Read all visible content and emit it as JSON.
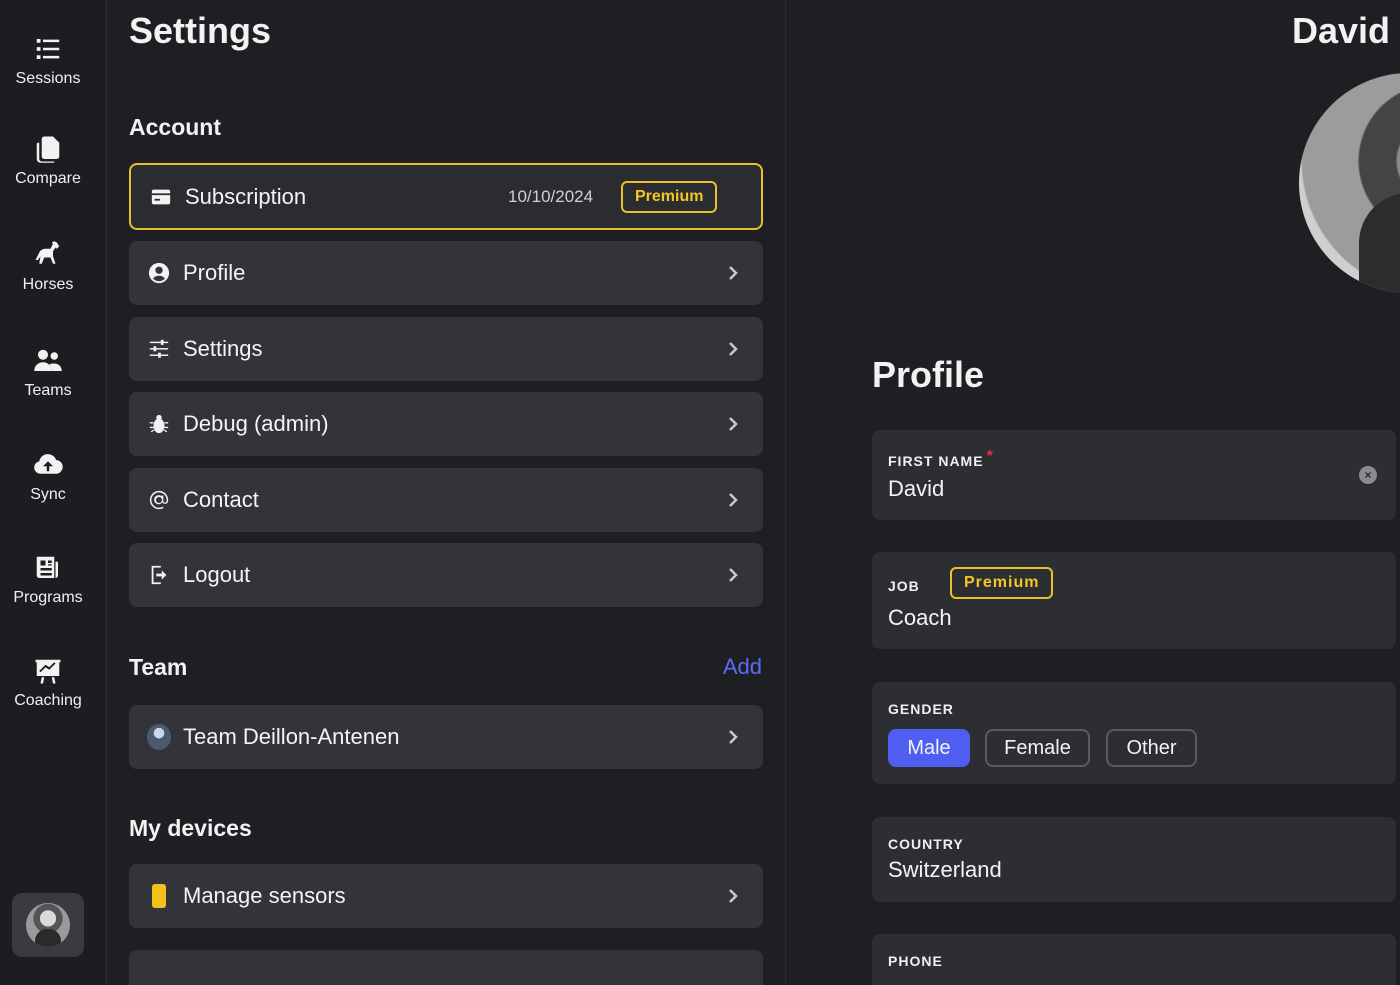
{
  "nav": {
    "items": [
      {
        "label": "Sessions",
        "icon": "list-icon"
      },
      {
        "label": "Compare",
        "icon": "copy-icon"
      },
      {
        "label": "Horses",
        "icon": "horse-icon"
      },
      {
        "label": "Teams",
        "icon": "users-icon"
      },
      {
        "label": "Sync",
        "icon": "cloud-upload-icon"
      },
      {
        "label": "Programs",
        "icon": "newspaper-icon"
      },
      {
        "label": "Coaching",
        "icon": "presentation-chart-icon"
      }
    ]
  },
  "settings": {
    "title": "Settings",
    "account_section": "Account",
    "subscription": {
      "label": "Subscription",
      "date": "10/10/2024",
      "badge": "Premium"
    },
    "menu": [
      {
        "label": "Profile",
        "icon": "user-circle-icon"
      },
      {
        "label": "Settings",
        "icon": "sliders-icon"
      },
      {
        "label": "Debug (admin)",
        "icon": "bug-icon"
      },
      {
        "label": "Contact",
        "icon": "at-icon"
      },
      {
        "label": "Logout",
        "icon": "logout-icon"
      }
    ],
    "team_section": "Team",
    "team_add": "Add",
    "team": {
      "label": "Team Deillon-Antenen"
    },
    "devices_section": "My devices",
    "devices": {
      "label": "Manage sensors"
    }
  },
  "profile": {
    "user_name": "David",
    "title": "Profile",
    "first_name": {
      "label": "FIRST NAME",
      "required_mark": "*",
      "value": "David",
      "clear": "×"
    },
    "job": {
      "label": "JOB",
      "badge": "Premium",
      "value": "Coach"
    },
    "gender": {
      "label": "GENDER",
      "options": [
        "Male",
        "Female",
        "Other"
      ],
      "selected": "Male"
    },
    "country": {
      "label": "COUNTRY",
      "value": "Switzerland"
    },
    "phone": {
      "label": "PHONE"
    }
  },
  "colors": {
    "accent": "#4f5ef0",
    "premium": "#f3c622",
    "background": "#1e1f22",
    "card": "#333439"
  }
}
